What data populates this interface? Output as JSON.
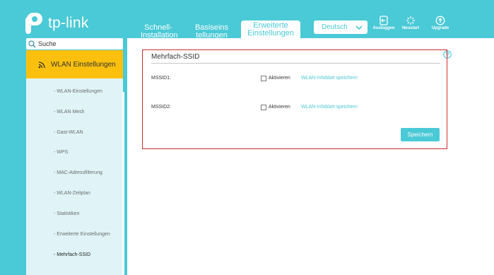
{
  "header": {
    "logo_text": "tp-link",
    "tabs": [
      {
        "line1": "Schnell-",
        "line2": "Installation"
      },
      {
        "line1": "Basiseins",
        "line2": "tellungen"
      },
      {
        "line1": "Erweiterte",
        "line2": "Einstellungen"
      }
    ],
    "language": "Deutsch",
    "tools": [
      {
        "label": "Ausloggen",
        "icon": "logout-icon"
      },
      {
        "label": "Neustart",
        "icon": "reboot-icon"
      },
      {
        "label": "Upgrade",
        "icon": "upgrade-icon"
      }
    ]
  },
  "sidebar": {
    "search_placeholder": "Suche",
    "category": "WLAN Einstellungen",
    "items": [
      "- WLAN-Einstellungen",
      "- WLAN Mesh",
      "- Gast-WLAN",
      "- WPS",
      "- MAC-Adressfilterung",
      "- WLAN-Zeitplan",
      "- Statistiken",
      "- Erweiterte Einstellungen",
      "- Mehrfach-SSID"
    ],
    "active_item": "- Mehrfach-SSID"
  },
  "panel": {
    "title": "Mehrfach-SSID",
    "rows": [
      {
        "label": "MSSID1:",
        "checkbox_label": "Aktivieren",
        "link": "WLAN-Infoblatt speichern"
      },
      {
        "label": "MSSID2:",
        "checkbox_label": "Aktivieren",
        "link": "WLAN-Infoblatt speichern"
      }
    ],
    "save_label": "Speichern"
  },
  "colors": {
    "accent": "#4ac9d6",
    "highlight": "#fbc00e",
    "panel_border": "#d22a2a"
  }
}
